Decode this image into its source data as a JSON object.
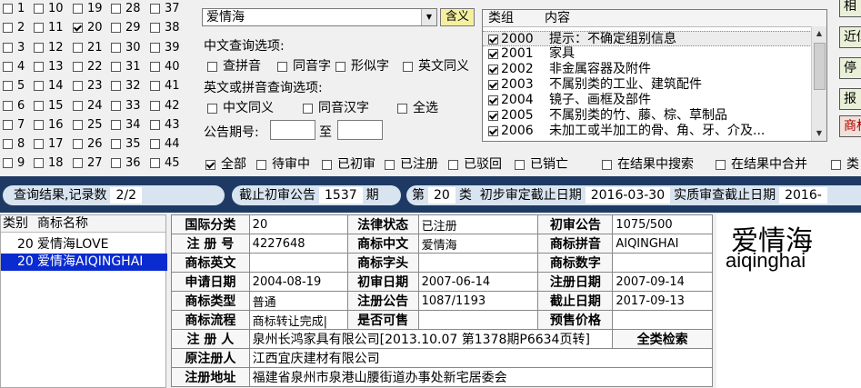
{
  "class_grid": {
    "cols": [
      [
        {
          "n": "1",
          "on": false
        },
        {
          "n": "2",
          "on": false
        },
        {
          "n": "3",
          "on": false
        },
        {
          "n": "4",
          "on": false
        },
        {
          "n": "5",
          "on": false
        },
        {
          "n": "6",
          "on": false
        },
        {
          "n": "7",
          "on": false
        },
        {
          "n": "8",
          "on": false
        },
        {
          "n": "9",
          "on": false
        }
      ],
      [
        {
          "n": "10",
          "on": false
        },
        {
          "n": "11",
          "on": false
        },
        {
          "n": "12",
          "on": false
        },
        {
          "n": "13",
          "on": false
        },
        {
          "n": "14",
          "on": false
        },
        {
          "n": "15",
          "on": false
        },
        {
          "n": "16",
          "on": false
        },
        {
          "n": "17",
          "on": false
        },
        {
          "n": "18",
          "on": false
        }
      ],
      [
        {
          "n": "19",
          "on": false
        },
        {
          "n": "20",
          "on": true
        },
        {
          "n": "21",
          "on": false
        },
        {
          "n": "22",
          "on": false
        },
        {
          "n": "23",
          "on": false
        },
        {
          "n": "24",
          "on": false
        },
        {
          "n": "25",
          "on": false
        },
        {
          "n": "26",
          "on": false
        },
        {
          "n": "27",
          "on": false
        }
      ],
      [
        {
          "n": "28",
          "on": false
        },
        {
          "n": "29",
          "on": false
        },
        {
          "n": "30",
          "on": false
        },
        {
          "n": "31",
          "on": false
        },
        {
          "n": "32",
          "on": false
        },
        {
          "n": "33",
          "on": false
        },
        {
          "n": "34",
          "on": false
        },
        {
          "n": "35",
          "on": false
        },
        {
          "n": "36",
          "on": false
        }
      ],
      [
        {
          "n": "37",
          "on": false
        },
        {
          "n": "38",
          "on": false
        },
        {
          "n": "39",
          "on": false
        },
        {
          "n": "40",
          "on": false
        },
        {
          "n": "41",
          "on": false
        },
        {
          "n": "42",
          "on": false
        },
        {
          "n": "43",
          "on": false
        },
        {
          "n": "44",
          "on": false
        },
        {
          "n": "45",
          "on": false
        }
      ]
    ]
  },
  "search": {
    "value": "爱情海",
    "meaning_button": "含义"
  },
  "cn_options": {
    "title": "中文查询选项:",
    "items": [
      "查拼音",
      "同音字",
      "形似字",
      "英文同义"
    ]
  },
  "en_options": {
    "title": "英文或拼音查询选项:",
    "items": [
      "中文同义",
      "同音汉字",
      "全选"
    ]
  },
  "issue": {
    "label": "公告期号:",
    "to": "至"
  },
  "group_list": {
    "col_group": "类组",
    "col_content": "内容",
    "rows": [
      {
        "code": "2000",
        "text": "提示：不确定组别信息",
        "sel": true
      },
      {
        "code": "2001",
        "text": "家具",
        "sel": false
      },
      {
        "code": "2002",
        "text": "非金属容器及附件",
        "sel": false
      },
      {
        "code": "2003",
        "text": "不属别类的工业、建筑配件",
        "sel": false
      },
      {
        "code": "2004",
        "text": "镜子、画框及部件",
        "sel": false
      },
      {
        "code": "2005",
        "text": "不属别类的竹、藤、棕、草制品",
        "sel": false
      },
      {
        "code": "2006",
        "text": "未加工或半加工的骨、角、牙、介及...",
        "sel": false
      }
    ]
  },
  "right_buttons": [
    "相",
    "近似",
    "停",
    "报",
    "商标"
  ],
  "status_filter": [
    {
      "label": "全部",
      "on": true
    },
    {
      "label": "待审中",
      "on": false
    },
    {
      "label": "已初审",
      "on": false
    },
    {
      "label": "已注册",
      "on": false
    },
    {
      "label": "已驳回",
      "on": false
    },
    {
      "label": "已销亡",
      "on": false
    },
    {
      "label": "在结果中搜索",
      "on": false
    },
    {
      "label": "在结果中合并",
      "on": false
    },
    {
      "label": "类",
      "on": false
    }
  ],
  "info_bar": {
    "result_label": "查询结果,记录数",
    "result_value": "2/2",
    "deadline_label": "截止初审公告",
    "deadline_value": "1537",
    "deadline_unit": "期",
    "class_prefix": "第",
    "class_value": "20",
    "class_suffix": "类",
    "prelim_label": "初步审定截止日期",
    "prelim_value": "2016-03-30",
    "exam_label": "实质审查截止日期",
    "exam_value": "2016-"
  },
  "result_list": {
    "col_class": "类别",
    "col_name": "商标名称",
    "rows": [
      {
        "cls": "20",
        "name": "爱情海LOVE",
        "sel": false
      },
      {
        "cls": "20",
        "name": "爱情海AIQINGHAI",
        "sel": true
      }
    ]
  },
  "detail": {
    "rows": [
      [
        "国际分类",
        "20",
        "法律状态",
        "已注册",
        "初审公告",
        "1075/500"
      ],
      [
        "注 册 号",
        "4227648",
        "商标中文",
        "爱情海",
        "商标拼音",
        "AIQINGHAI"
      ],
      [
        "商标英文",
        "",
        "商标字头",
        "",
        "商标数字",
        ""
      ],
      [
        "申请日期",
        "2004-08-19",
        "初审日期",
        "2007-06-14",
        "注册日期",
        "2007-09-14"
      ],
      [
        "商标类型",
        "普通",
        "注册公告",
        "1087/1193",
        "截止日期",
        "2017-09-13"
      ],
      [
        "商标流程",
        "商标转让完成|",
        "是否可售",
        "",
        "预售价格",
        ""
      ]
    ],
    "registrant_label": "注 册 人",
    "registrant_value": "泉州长鸿家具有限公司[2013.10.07 第1378期P6634页转]",
    "full_search": "全类检索",
    "orig_label": "原注册人",
    "orig_value": "江西宜庆建材有限公司",
    "addr_label": "注册地址",
    "addr_value": "福建省泉州市泉港山腰街道办事处新宅居委会"
  },
  "preview": {
    "cn": "爱情海",
    "en": "aiqinghai"
  }
}
